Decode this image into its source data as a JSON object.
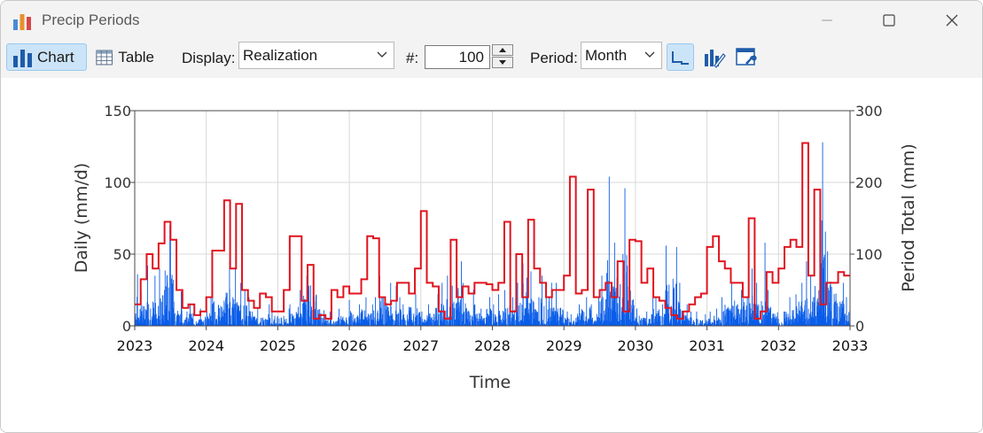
{
  "window": {
    "title": "Precip Periods",
    "controls": [
      "minimize-icon",
      "maximize-icon",
      "close-icon"
    ]
  },
  "toolbar": {
    "chart_label": "Chart",
    "table_label": "Table",
    "display_label": "Display:",
    "display_value": "Realization",
    "number_label": "#:",
    "number_value": "100",
    "period_label": "Period:",
    "period_value": "Month"
  },
  "colors": {
    "daily": "#0a5de8",
    "period_total": "#e0141e",
    "grid": "#d8d8d8",
    "accent": "#cce4f7"
  },
  "chart_data": {
    "type": "bar+line",
    "xlabel": "Time",
    "ylabel_left": "Daily (mm/d)",
    "ylabel_right": "Period Total (mm)",
    "x_range": [
      "2023",
      "2033"
    ],
    "x_ticks": [
      "2023",
      "2024",
      "2025",
      "2026",
      "2027",
      "2028",
      "2029",
      "2030",
      "2031",
      "2032",
      "2033"
    ],
    "y_left_range": [
      0,
      150
    ],
    "y_left_ticks": [
      0,
      50,
      100,
      150
    ],
    "y_right_range": [
      0,
      300
    ],
    "y_right_ticks": [
      0,
      100,
      200,
      300
    ],
    "grid": true,
    "series": [
      {
        "role": "daily",
        "axis": "left",
        "style": "bars",
        "monthly_peak_values": [
          36,
          25,
          42,
          35,
          40,
          70,
          60,
          24,
          10,
          15,
          8,
          12,
          20,
          30,
          25,
          45,
          40,
          30,
          25,
          20,
          12,
          10,
          15,
          12,
          10,
          12,
          15,
          25,
          35,
          48,
          40,
          20,
          10,
          8,
          12,
          10,
          18,
          15,
          20,
          15,
          20,
          35,
          30,
          28,
          20,
          15,
          28,
          22,
          10,
          15,
          22,
          30,
          35,
          28,
          45,
          30,
          25,
          15,
          12,
          20,
          15,
          22,
          25,
          20,
          30,
          73,
          38,
          20,
          35,
          58,
          30,
          25,
          10,
          8,
          15,
          20,
          25,
          20,
          35,
          104,
          58,
          50,
          96,
          45,
          12,
          10,
          20,
          20,
          15,
          56,
          55,
          30,
          15,
          10,
          10,
          8,
          10,
          12,
          20,
          25,
          30,
          25,
          35,
          40,
          30,
          58,
          25,
          18,
          10,
          20,
          22,
          30,
          45,
          35,
          50,
          128,
          52,
          45,
          30,
          20
        ]
      },
      {
        "role": "period_total",
        "axis": "right",
        "style": "step",
        "monthly_values": [
          30,
          65,
          100,
          80,
          115,
          145,
          120,
          50,
          25,
          30,
          15,
          20,
          40,
          105,
          105,
          175,
          80,
          170,
          50,
          35,
          25,
          45,
          40,
          20,
          20,
          50,
          125,
          125,
          35,
          85,
          10,
          15,
          10,
          50,
          40,
          55,
          45,
          45,
          65,
          125,
          122,
          40,
          30,
          35,
          60,
          60,
          45,
          80,
          160,
          60,
          55,
          20,
          10,
          120,
          40,
          55,
          45,
          60,
          60,
          58,
          50,
          60,
          145,
          20,
          100,
          40,
          148,
          80,
          60,
          40,
          50,
          50,
          70,
          208,
          45,
          50,
          190,
          40,
          50,
          60,
          40,
          90,
          20,
          120,
          118,
          60,
          80,
          40,
          35,
          25,
          15,
          10,
          20,
          30,
          40,
          45,
          110,
          125,
          90,
          80,
          60,
          60,
          40,
          150,
          10,
          20,
          75,
          60,
          80,
          110,
          120,
          110,
          255,
          70,
          190,
          30,
          60,
          60,
          75,
          70
        ]
      }
    ]
  }
}
